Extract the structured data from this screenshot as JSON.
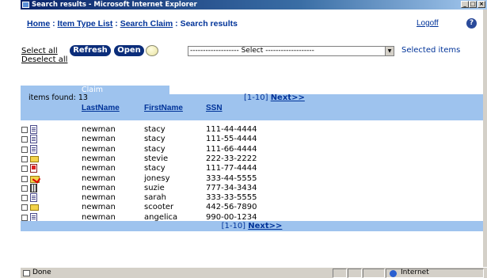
{
  "window": {
    "title": "Search results - Microsoft Internet Explorer",
    "buttons": [
      "_",
      "□",
      "×"
    ]
  },
  "breadcrumb": {
    "home": "Home",
    "sep": " : ",
    "item_type_list": "Item Type List",
    "search_claim": "Search Claim",
    "current": "Search results"
  },
  "header": {
    "logoff": "Logoff",
    "help": "?"
  },
  "toolbar": {
    "select_all": "Select all",
    "deselect_all": "Deselect all",
    "refresh": "Refresh",
    "open": "Open",
    "select_value": "------------------- Select -------------------",
    "selected_items": "Selected items"
  },
  "results": {
    "tab": "Claim",
    "items_found": "items found: 13",
    "range": "[1-10]",
    "next": "Next>>",
    "columns": [
      "LastName",
      "FirstName",
      "SSN"
    ],
    "rows": [
      {
        "icon": "document-icon",
        "last": "newman",
        "first": "stacy",
        "ssn": "111-44-4444"
      },
      {
        "icon": "document-icon",
        "last": "newman",
        "first": "stacy",
        "ssn": "111-55-4444"
      },
      {
        "icon": "document-icon",
        "last": "newman",
        "first": "stacy",
        "ssn": "111-66-4444"
      },
      {
        "icon": "folder-icon",
        "last": "newman",
        "first": "stevie",
        "ssn": "222-33-2222"
      },
      {
        "icon": "red-document-icon",
        "last": "newman",
        "first": "stacy",
        "ssn": "111-77-4444"
      },
      {
        "icon": "folder-check-icon",
        "last": "newman",
        "first": "jonesy",
        "ssn": "333-44-5555"
      },
      {
        "icon": "film-icon",
        "last": "newman",
        "first": "suzie",
        "ssn": "777-34-3434"
      },
      {
        "icon": "document-icon",
        "last": "newman",
        "first": "sarah",
        "ssn": "333-33-5555"
      },
      {
        "icon": "folder-icon",
        "last": "newman",
        "first": "scooter",
        "ssn": "442-56-7890"
      },
      {
        "icon": "document-icon",
        "last": "newman",
        "first": "angelica",
        "ssn": "990-00-1234"
      }
    ]
  },
  "status": {
    "text": "Done",
    "zone": "Internet"
  }
}
